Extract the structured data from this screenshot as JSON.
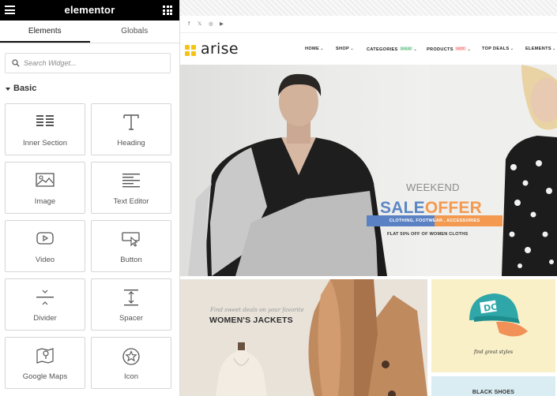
{
  "editor": {
    "brand": "elementor",
    "tabs": [
      "Elements",
      "Globals"
    ],
    "search_placeholder": "Search Widget...",
    "category": "Basic",
    "widgets": [
      {
        "label": "Inner Section",
        "icon": "inner-section-icon"
      },
      {
        "label": "Heading",
        "icon": "heading-icon"
      },
      {
        "label": "Image",
        "icon": "image-icon"
      },
      {
        "label": "Text Editor",
        "icon": "text-editor-icon"
      },
      {
        "label": "Video",
        "icon": "video-icon"
      },
      {
        "label": "Button",
        "icon": "button-icon"
      },
      {
        "label": "Divider",
        "icon": "divider-icon"
      },
      {
        "label": "Spacer",
        "icon": "spacer-icon"
      },
      {
        "label": "Google Maps",
        "icon": "google-maps-icon"
      },
      {
        "label": "Icon",
        "icon": "star-icon"
      }
    ]
  },
  "site": {
    "social": [
      "f",
      "𝕏",
      "◎",
      "▶"
    ],
    "brand": "arise",
    "nav": [
      {
        "label": "HOME"
      },
      {
        "label": "SHOP"
      },
      {
        "label": "CATEGORIES",
        "tag": "SALE"
      },
      {
        "label": "PRODUCTS",
        "tag": "HOT"
      },
      {
        "label": "TOP DEALS"
      },
      {
        "label": "ELEMENTS"
      }
    ],
    "hero": {
      "kicker": "WEEKEND",
      "headline_a": "SALE",
      "headline_b": "OFFER",
      "ribbon": "CLOTHING, FOOTWEAR , ACCESSORIES",
      "subline": "FLAT 50% OFF OF WOMEN CLOTHS"
    },
    "promo_jackets": {
      "sub": "Find sweet deals on your favorite",
      "title": "WOMEN'S JACKETS"
    },
    "promo_caps": {
      "text": "find great styles"
    },
    "promo_shoes": {
      "title": "BLACK SHOES"
    }
  },
  "colors": {
    "sale_blue": "#5c86c4",
    "offer_orange": "#f39a50",
    "brand_yellow": "#f4c415"
  }
}
